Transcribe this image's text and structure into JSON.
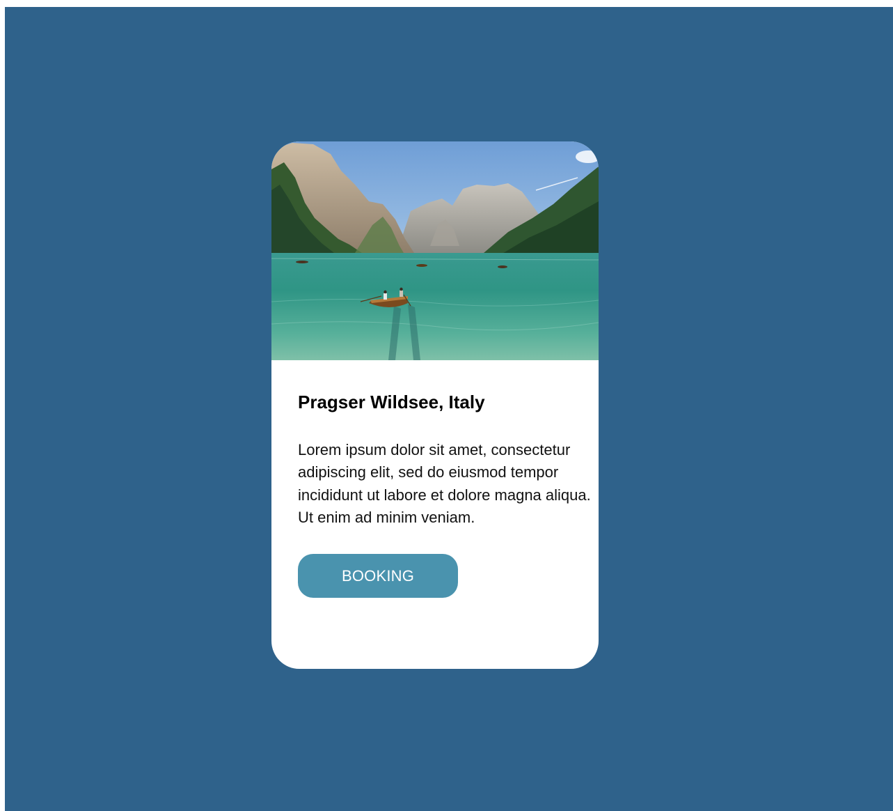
{
  "card": {
    "image_alt": "Pragser Wildsee, Italy",
    "title": "Pragser Wildsee, Italy",
    "description": "Lorem ipsum dolor sit amet, consectetur adipiscing elit, sed do eiusmod tempor incididunt ut labore et dolore magna aliqua. Ut enim ad minim veniam.",
    "button_label": "BOOKING"
  },
  "colors": {
    "background": "#2f628b",
    "card": "#ffffff",
    "button": "#4a93ae",
    "button_text": "#ffffff"
  }
}
